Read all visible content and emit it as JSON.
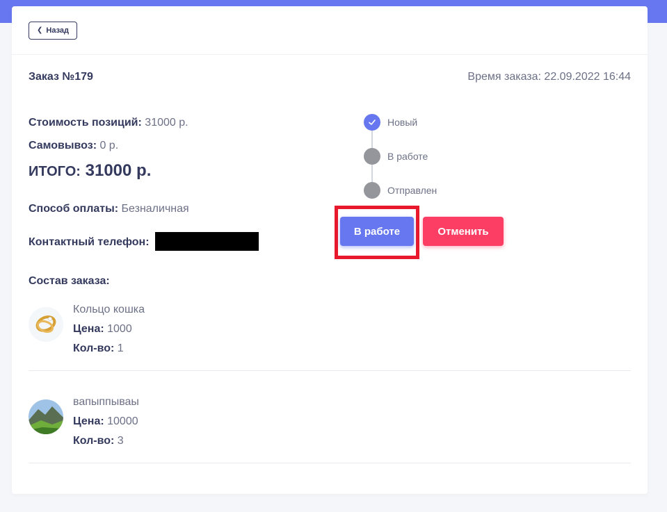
{
  "header": {
    "back_label": "Назад"
  },
  "order": {
    "title": "Заказ №179",
    "time": "Время заказа: 22.09.2022 16:44",
    "positions_cost_label": "Стоимость позиций:",
    "positions_cost_value": " 31000 р.",
    "pickup_label": "Самовывоз:",
    "pickup_value": " 0 р.",
    "total_label": "ИТОГО:",
    "total_value": " 31000 р.",
    "payment_label": "Способ оплаты:",
    "payment_value": " Безналичная",
    "phone_label": "Контактный телефон:",
    "composition_title": "Состав заказа:"
  },
  "items": [
    {
      "name": "Кольцо кошка",
      "price_label": "Цена:",
      "price_value": " 1000",
      "qty_label": "Кол-во:",
      "qty_value": " 1"
    },
    {
      "name": "вапыппываы",
      "price_label": "Цена:",
      "price_value": " 10000",
      "qty_label": "Кол-во:",
      "qty_value": " 3"
    }
  ],
  "statuses": [
    {
      "label": "Новый",
      "active": true
    },
    {
      "label": "В работе",
      "active": false
    },
    {
      "label": "Отправлен",
      "active": false
    }
  ],
  "actions": {
    "in_work_label": "В работе",
    "cancel_label": "Отменить"
  },
  "colors": {
    "accent": "#6777ef",
    "danger": "#fc3e64",
    "highlight": "#e8192c"
  }
}
